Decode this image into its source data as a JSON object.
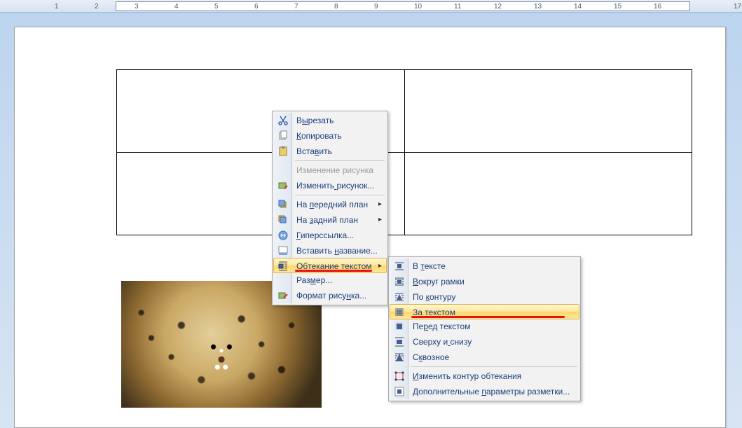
{
  "ruler": {
    "numbers": [
      "3",
      "",
      "2",
      "",
      "1",
      "",
      "",
      "",
      "1",
      "",
      "2",
      "",
      "3",
      "",
      "4",
      "",
      "5",
      "",
      "6",
      "",
      "7",
      "",
      "8",
      "",
      "9",
      "",
      "10",
      "",
      "11",
      "",
      "12",
      "",
      "13",
      "",
      "14",
      "",
      "15",
      "",
      "16",
      "",
      "",
      "",
      "17"
    ]
  },
  "context_menu": {
    "items": [
      {
        "key": "cut",
        "label": "Вырезать",
        "u": 1,
        "icon": "cut-icon"
      },
      {
        "key": "copy",
        "label": "Копировать",
        "u": 0,
        "icon": "copy-icon"
      },
      {
        "key": "paste",
        "label": "Вставить",
        "u": 4,
        "icon": "paste-icon"
      },
      {
        "sep": true
      },
      {
        "key": "change_pic",
        "label": "Изменение рисунка",
        "disabled": true
      },
      {
        "key": "edit_pic",
        "label": "Изменить рисунок...",
        "u": 8,
        "icon": "edit-icon"
      },
      {
        "sep": true
      },
      {
        "key": "front",
        "label": "На передний план",
        "u": 3,
        "icon": "front-icon",
        "sub": true
      },
      {
        "key": "back",
        "label": "На задний план",
        "u": 3,
        "icon": "back-icon",
        "sub": true
      },
      {
        "key": "hyper",
        "label": "Гиперссылка...",
        "u": 0,
        "icon": "link-icon"
      },
      {
        "key": "caption",
        "label": "Вставить название...",
        "u": 9,
        "icon": "caption-icon"
      },
      {
        "key": "wrap",
        "label": "Обтекание текстом",
        "u": 10,
        "icon": "wrap-icon",
        "sub": true,
        "highlight": true,
        "redline": true
      },
      {
        "key": "size",
        "label": "Размер...",
        "u": 3
      },
      {
        "key": "format",
        "label": "Формат рисунка...",
        "u": 11,
        "icon": "format-icon"
      }
    ]
  },
  "wrap_submenu": {
    "items": [
      {
        "key": "inline",
        "label": "В тексте",
        "u": 2,
        "icon": "wrap-inline-icon"
      },
      {
        "key": "square",
        "label": "Вокруг рамки",
        "u": 0,
        "icon": "wrap-square-icon"
      },
      {
        "key": "tight",
        "label": "По контуру",
        "u": 3,
        "icon": "wrap-tight-icon"
      },
      {
        "key": "behind",
        "label": "За текстом",
        "u": 0,
        "icon": "wrap-behind-icon",
        "highlight": true,
        "redline": true
      },
      {
        "key": "front",
        "label": "Перед текстом",
        "u": 2,
        "icon": "wrap-front-icon"
      },
      {
        "key": "topbot",
        "label": "Сверху и снизу",
        "u": 8,
        "icon": "wrap-topbot-icon"
      },
      {
        "key": "through",
        "label": "Сквозное",
        "u": 1,
        "icon": "wrap-through-icon"
      },
      {
        "sep": true
      },
      {
        "key": "editwrap",
        "label": "Изменить контур обтекания",
        "u": 0,
        "icon": "editwrap-icon"
      },
      {
        "key": "more",
        "label": "Дополнительные параметры разметки...",
        "u": 15,
        "icon": "more-icon"
      }
    ]
  },
  "image": {
    "alt": "leopard-photo"
  }
}
